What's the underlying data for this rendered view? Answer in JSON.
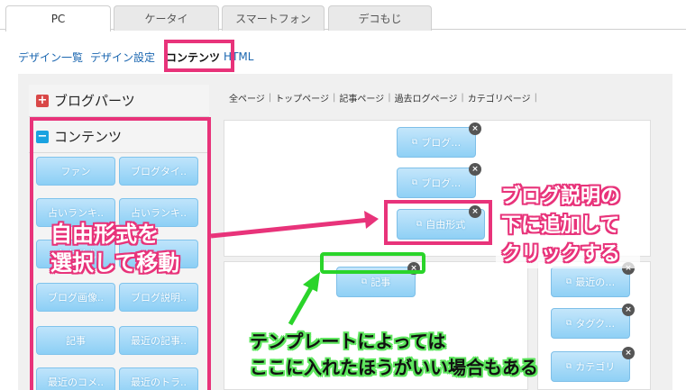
{
  "device_tabs": [
    "PC",
    "ケータイ",
    "スマートフォン",
    "デコもじ"
  ],
  "subnav": {
    "design_list": "デザイン一覧",
    "design_settings": "デザイン設定",
    "contents": "コンテンツ",
    "html": "HTML"
  },
  "sidebar": {
    "blog_parts": "ブログパーツ",
    "contents": "コンテンツ",
    "plus_icon": "+",
    "minus_icon": "−",
    "parts": [
      "ファン",
      "ブログタイ..",
      "占いランキ..",
      "占いランキ..",
      "自由形式",
      "",
      "ブログ画像..",
      "ブログ説明..",
      "記事",
      "最近の記事..",
      "最近のコメ..",
      "最近のトラ.."
    ]
  },
  "page_tabs": [
    "全ページ",
    "トップページ",
    "記事ページ",
    "過去ログページ",
    "カテゴリページ"
  ],
  "template": {
    "top_blocks": [
      "ブログ…",
      "ブログ…",
      "自由形式"
    ],
    "main_block": "記事",
    "right_blocks": [
      "最近の…",
      "タグク…",
      "カテゴリ"
    ],
    "close_icon": "×"
  },
  "annotations": {
    "select_move": [
      "自由形式を",
      "選択して移動"
    ],
    "add_below": [
      "ブログ説明の",
      "下に追加して",
      "クリックする"
    ],
    "template_note": [
      "テンプレートによっては",
      "ここに入れたほうがいい場合もある"
    ]
  },
  "colors": {
    "highlight_pink": "#e8337a",
    "highlight_green": "#2ad42a",
    "part_blue": "#8ccff5"
  }
}
